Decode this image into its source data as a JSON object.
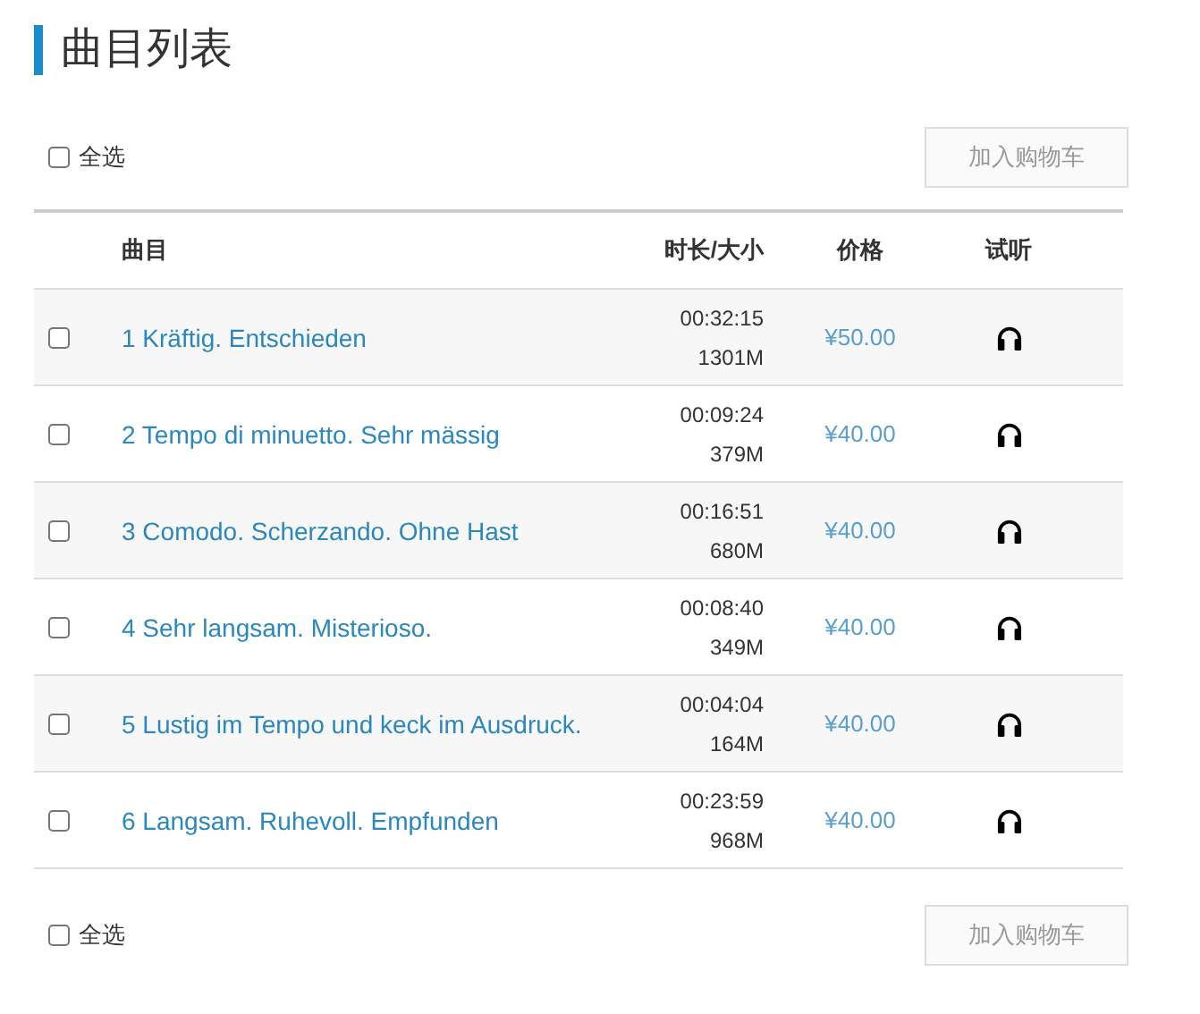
{
  "title": "曲目列表",
  "top_bar": {
    "select_all": {
      "label": "全选",
      "checked": false
    },
    "button": "加入购物车"
  },
  "table": {
    "columns": [
      "曲目",
      "时长/大小",
      "价格",
      "试听"
    ],
    "rows": [
      {
        "title": "1 Kräftig. Entschieden",
        "duration": "00:32:15",
        "size": "1301M",
        "price": "¥50.00",
        "checked": false
      },
      {
        "title": "2 Tempo di minuetto. Sehr mässig",
        "duration": "00:09:24",
        "size": "379M",
        "price": "¥40.00",
        "checked": false
      },
      {
        "title": "3 Comodo. Scherzando. Ohne Hast",
        "duration": "00:16:51",
        "size": "680M",
        "price": "¥40.00",
        "checked": false
      },
      {
        "title": "4 Sehr langsam. Misterioso.",
        "duration": "00:08:40",
        "size": "349M",
        "price": "¥40.00",
        "checked": false
      },
      {
        "title": "5 Lustig im Tempo und keck im Ausdruck.",
        "duration": "00:04:04",
        "size": "164M",
        "price": "¥40.00",
        "checked": false
      },
      {
        "title": "6 Langsam. Ruhevoll. Empfunden",
        "duration": "00:23:59",
        "size": "968M",
        "price": "¥40.00",
        "checked": false
      }
    ]
  },
  "bottom_bar": {
    "select_all": {
      "label": "全选",
      "checked": false
    },
    "button": "加入购物车"
  }
}
